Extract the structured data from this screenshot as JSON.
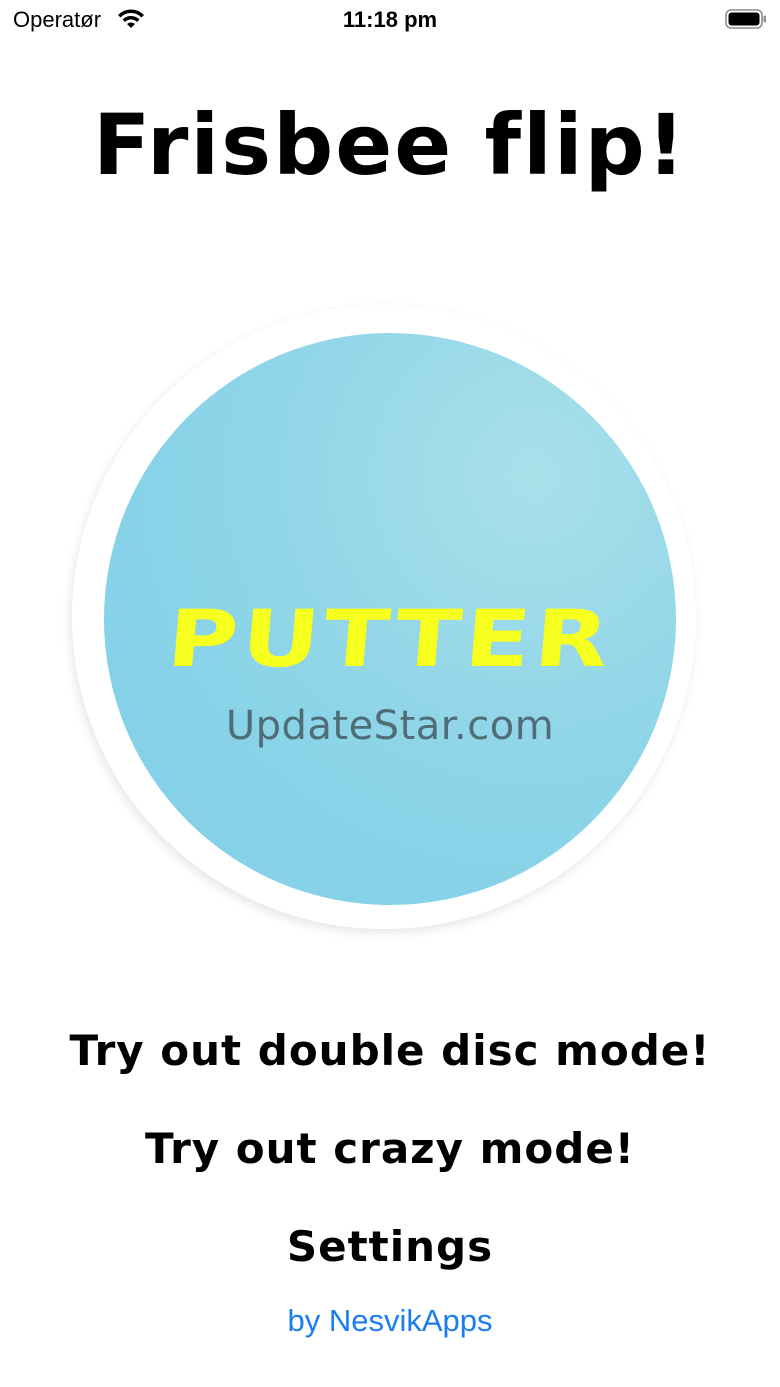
{
  "status_bar": {
    "carrier": "Operatør",
    "time": "11:18 pm",
    "wifi_icon": "wifi-icon",
    "battery_icon": "battery-icon"
  },
  "title": "Frisbee flip!",
  "disc": {
    "brand_text": "PUTTER",
    "watermark": "UpdateStar.com",
    "colors": {
      "face": "#86d2e8",
      "brand": "#f6ff1e",
      "rim": "#ffffff"
    }
  },
  "menu": {
    "double_disc": "Try out double disc mode!",
    "crazy": "Try out crazy mode!",
    "settings": "Settings"
  },
  "credits": "by NesvikApps",
  "colors": {
    "link": "#1a7ef0",
    "text": "#000000",
    "background": "#ffffff"
  }
}
